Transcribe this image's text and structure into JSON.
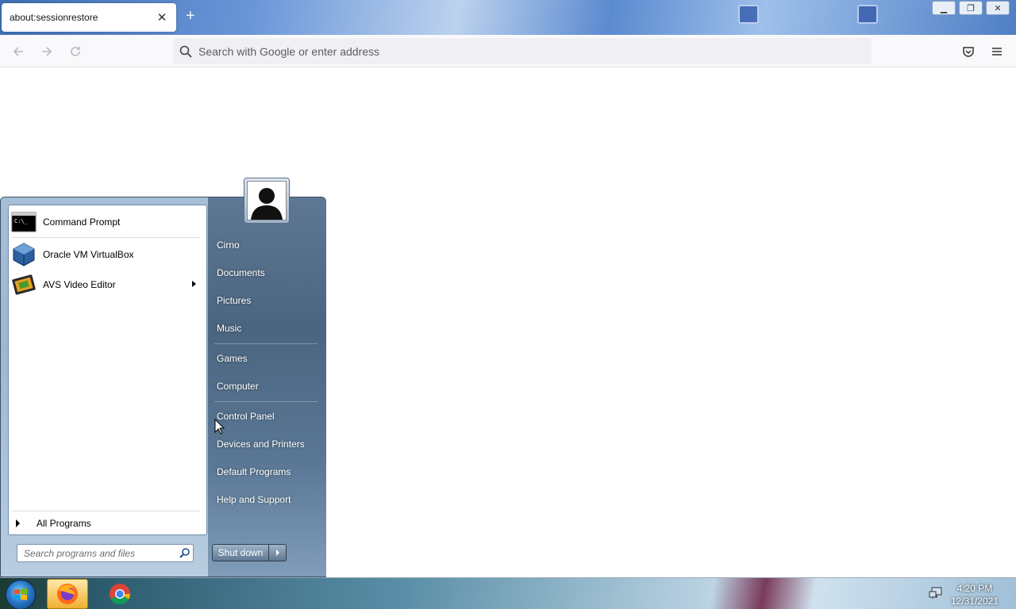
{
  "browser": {
    "tab_title": "about:sessionrestore",
    "url_placeholder": "Search with Google or enter address",
    "icons": [
      "back-icon",
      "forward-icon",
      "reload-icon",
      "search-icon",
      "pocket-icon",
      "menu-icon",
      "close-icon",
      "plus-icon",
      "minimize-icon",
      "restore-icon"
    ]
  },
  "start_menu": {
    "programs": [
      {
        "label": "Command Prompt",
        "icon": "command-prompt-icon"
      },
      {
        "label": "Oracle VM VirtualBox",
        "icon": "virtualbox-icon"
      },
      {
        "label": "AVS Video Editor",
        "icon": "video-editor-icon",
        "has_submenu": true
      }
    ],
    "all_programs": "All Programs",
    "search_placeholder": "Search programs and files",
    "right_items": [
      "Cirno",
      "Documents",
      "Pictures",
      "Music",
      "Games",
      "Computer",
      "Control Panel",
      "Devices and Printers",
      "Default Programs",
      "Help and Support"
    ],
    "shutdown_label": "Shut down"
  },
  "taskbar": {
    "time": "4:20 PM",
    "date": "12/31/2021",
    "apps": [
      "firefox-icon",
      "chrome-icon"
    ]
  }
}
